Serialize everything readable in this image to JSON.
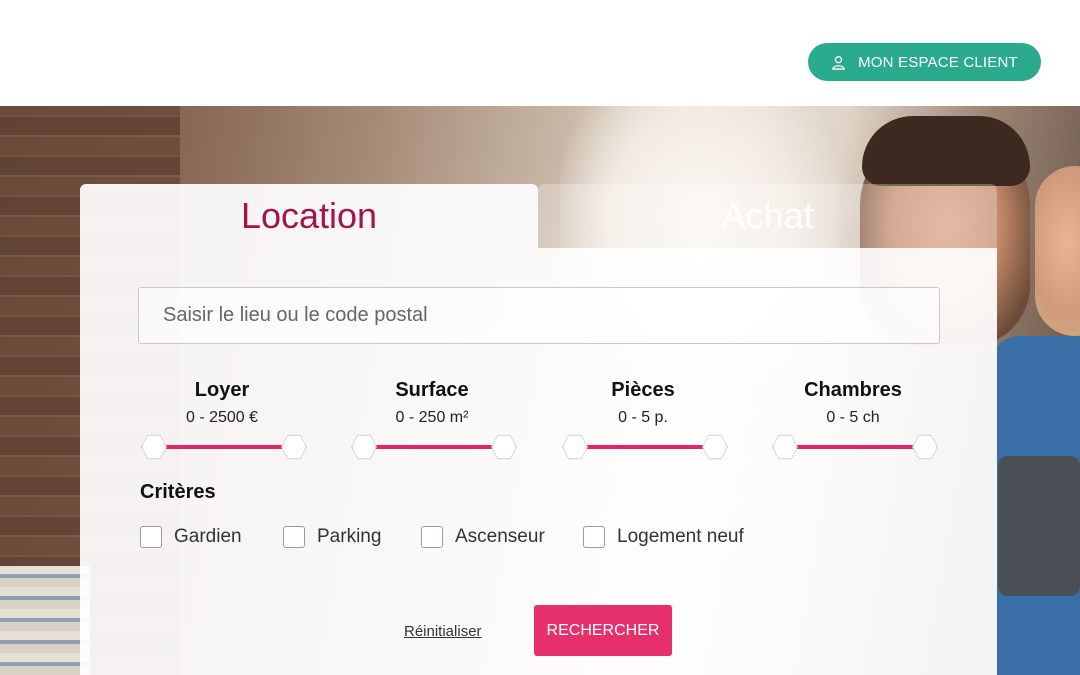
{
  "header": {
    "client_button_label": "MON ESPACE CLIENT",
    "client_button_icon": "user-icon",
    "client_button_color": "#2bab8e"
  },
  "tabs": [
    {
      "label": "Location",
      "active": true,
      "color": "#a3154a"
    },
    {
      "label": "Achat",
      "active": false
    }
  ],
  "search": {
    "placeholder": "Saisir le lieu ou le code postal",
    "value": ""
  },
  "ranges": [
    {
      "title": "Loyer",
      "value": "0 - 2500 €"
    },
    {
      "title": "Surface",
      "value": "0 - 250 m²"
    },
    {
      "title": "Pièces",
      "value": "0 - 5 p."
    },
    {
      "title": "Chambres",
      "value": "0 - 5 ch"
    }
  ],
  "range_track_color": "#e0256a",
  "criteres": {
    "title": "Critères",
    "options": [
      {
        "label": "Gardien",
        "checked": false
      },
      {
        "label": "Parking",
        "checked": false
      },
      {
        "label": "Ascenseur",
        "checked": false
      },
      {
        "label": "Logement neuf",
        "checked": false
      }
    ]
  },
  "actions": {
    "reset_label": "Réinitialiser",
    "search_label": "RECHERCHER",
    "search_color": "#e6306c"
  }
}
